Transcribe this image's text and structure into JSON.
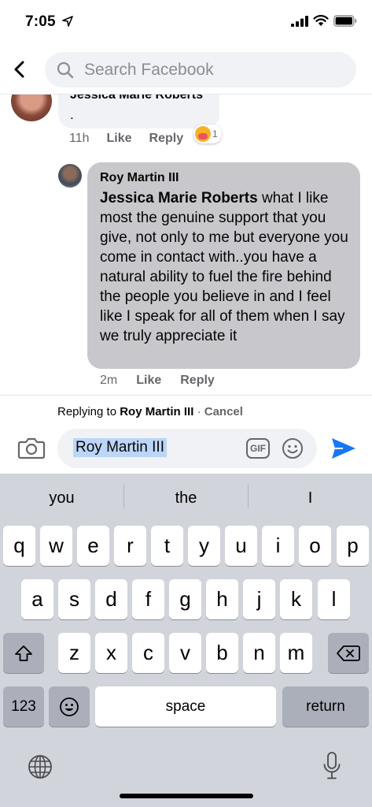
{
  "status_bar": {
    "time": "7:05",
    "icons": [
      "location-arrow-icon",
      "signal-icon",
      "wifi-icon",
      "battery-icon"
    ]
  },
  "header": {
    "back_icon": "chevron-left-icon",
    "search_placeholder": "Search Facebook"
  },
  "comments": [
    {
      "author": "Jessica Marie Roberts",
      "text": ".",
      "time": "11h",
      "like_label": "Like",
      "reply_label": "Reply",
      "reaction_count": "1",
      "reaction_icon": "care-emoji-icon"
    },
    {
      "author": "Roy Martin III",
      "mention": "Jessica Marie Roberts",
      "text": " what I like most the genuine support that you give, not only to me but everyone you come in contact with..you have a natural ability to fuel the fire behind the people you believe in and I feel like I speak for all of them when I say we truly appreciate it",
      "time": "2m",
      "like_label": "Like",
      "reply_label": "Reply"
    }
  ],
  "reply_bar": {
    "prefix": "Replying to ",
    "target": "Roy Martin III",
    "separator": " · ",
    "cancel_label": "Cancel",
    "composer_value": "Roy Martin III",
    "gif_label": "GIF"
  },
  "keyboard": {
    "suggestions": [
      "you",
      "the",
      "I"
    ],
    "row1": [
      "q",
      "w",
      "e",
      "r",
      "t",
      "y",
      "u",
      "i",
      "o",
      "p"
    ],
    "row2": [
      "a",
      "s",
      "d",
      "f",
      "g",
      "h",
      "j",
      "k",
      "l"
    ],
    "row3": [
      "z",
      "x",
      "c",
      "v",
      "b",
      "n",
      "m"
    ],
    "numbers_label": "123",
    "space_label": "space",
    "return_label": "return"
  },
  "colors": {
    "accent": "#1877f2",
    "bubble_gray": "#f0f2f5",
    "selected_bubble": "#c8c8cc",
    "keyboard_bg": "#d1d4db"
  }
}
